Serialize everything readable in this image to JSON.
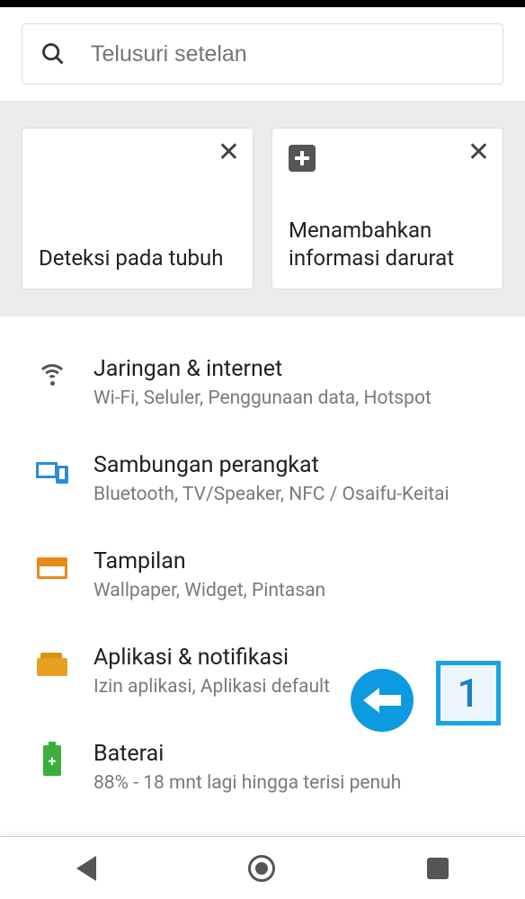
{
  "search": {
    "placeholder": "Telusuri setelan"
  },
  "suggestions": [
    {
      "title": "Deteksi pada tubuh",
      "has_plus": false
    },
    {
      "title": "Menambahkan informasi darurat",
      "has_plus": true
    }
  ],
  "items": [
    {
      "title": "Jaringan & internet",
      "sub": "Wi-Fi, Seluler, Penggunaan data, Hotspot"
    },
    {
      "title": "Sambungan perangkat",
      "sub": "Bluetooth, TV/Speaker, NFC / Osaifu-Keitai"
    },
    {
      "title": "Tampilan",
      "sub": "Wallpaper, Widget, Pintasan"
    },
    {
      "title": "Aplikasi & notifikasi",
      "sub": "Izin aplikasi, Aplikasi default"
    },
    {
      "title": "Baterai",
      "sub": "88% - 18 mnt lagi hingga terisi penuh"
    }
  ],
  "annotation": {
    "number": "1"
  }
}
